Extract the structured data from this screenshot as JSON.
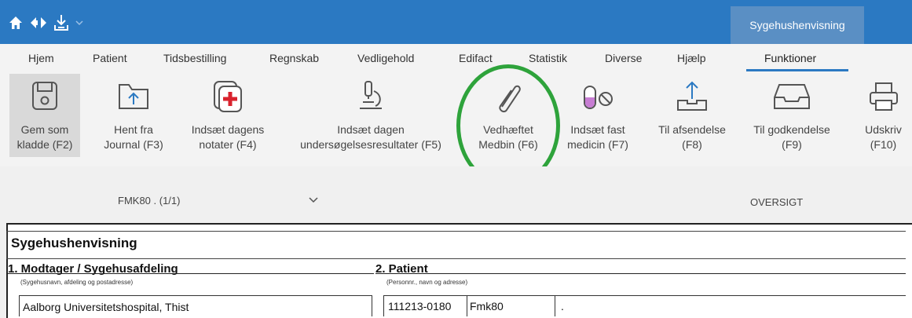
{
  "window": {
    "title_tab": "Sygehushenvisning"
  },
  "quick_access": {
    "icons": [
      "home-icon",
      "arrows-icon",
      "download-icon",
      "chevron-down-icon"
    ]
  },
  "ribbon_tabs": [
    {
      "label": "Hjem"
    },
    {
      "label": "Patient"
    },
    {
      "label": "Tidsbestilling"
    },
    {
      "label": "Regnskab"
    },
    {
      "label": "Vedligehold"
    },
    {
      "label": "Edifact"
    },
    {
      "label": "Statistik"
    },
    {
      "label": "Diverse"
    },
    {
      "label": "Hjælp"
    },
    {
      "label": "Funktioner",
      "active": true
    }
  ],
  "ribbon_buttons": [
    {
      "label": "Gem som\nkladde (F2)",
      "icon": "save-icon"
    },
    {
      "label": "Hent fra\nJournal (F3)",
      "icon": "folder-upload-icon"
    },
    {
      "label": "Indsæt dagens\nnotater (F4)",
      "icon": "add-notes-icon"
    },
    {
      "label": "Indsæt dagen\nundersøgelsesresultater (F5)",
      "icon": "microscope-icon"
    },
    {
      "label": "Vedhæftet\nMedbin (F6)",
      "icon": "paperclip-icon"
    },
    {
      "label": "Indsæt fast\nmedicin (F7)",
      "icon": "medicine-icon"
    },
    {
      "label": "Til afsendelse\n(F8)",
      "icon": "send-tray-icon"
    },
    {
      "label": "Til godkendelse\n(F9)",
      "icon": "inbox-tray-icon"
    },
    {
      "label": "Udskriv\n(F10)",
      "icon": "printer-icon"
    }
  ],
  "subbar": {
    "document_selector": "FMK80 . (1/1)",
    "overview_label": "OVERSIGT"
  },
  "document": {
    "title": "Sygehushenvisning",
    "section1": {
      "heading": "1. Modtager / Sygehusafdeling",
      "hint": "(Sygehusnavn, afdeling og postadresse)",
      "value": "Aalborg Universitetshospital, Thist"
    },
    "section2": {
      "heading": "2. Patient",
      "hint": "(Personnr., navn og adresse)",
      "cpr": "111213-0180",
      "name": "Fmk80",
      "address": "."
    }
  },
  "colors": {
    "titlebar": "#2b79c2",
    "highlight_circle": "#2ea33b",
    "active_tab_underline": "#2b79c2"
  }
}
